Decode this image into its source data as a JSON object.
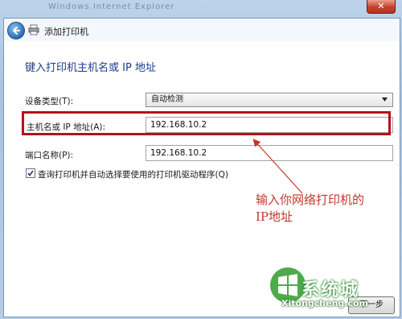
{
  "window": {
    "faded_title": "Windows Internet Explorer",
    "close_label": "✕"
  },
  "nav": {
    "title": "添加打印机"
  },
  "heading": "键入打印机主机名或 IP 地址",
  "form": {
    "device_type_label": "设备类型(T):",
    "device_type_value": "自动检测",
    "hostname_label": "主机名或 IP 地址(A):",
    "hostname_value": "192.168.10.2",
    "port_label": "端口名称(P):",
    "port_value": "192.168.10.2",
    "autoselect_label": "查询打印机并自动选择要使用的打印机驱动程序(Q)",
    "autoselect_checked": true
  },
  "annotation": {
    "text": "输入你网络打印机的\nIP地址",
    "color": "#c0392b"
  },
  "footer": {
    "next_label": "下一步"
  },
  "watermark": {
    "brand": "系统城",
    "url": "Xitongcheng.com"
  },
  "colors": {
    "highlight": "#b5121b",
    "heading": "#1e3a8a"
  }
}
